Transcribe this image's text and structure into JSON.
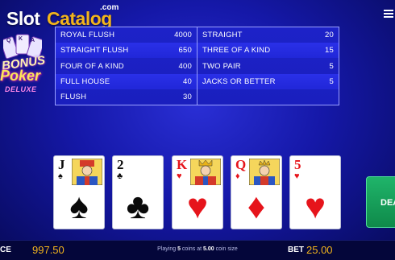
{
  "brand": {
    "slot": "Slot",
    "catalog": "Catalog",
    "com": ".com"
  },
  "game_logo": {
    "line1": "BONUS",
    "line2": "Poker",
    "line3": "DELUXE",
    "card_ranks": [
      "Q",
      "K",
      "A"
    ]
  },
  "paytable": {
    "left": [
      {
        "hand": "ROYAL FLUSH",
        "pay": "4000"
      },
      {
        "hand": "STRAIGHT FLUSH",
        "pay": "650"
      },
      {
        "hand": "FOUR OF A KIND",
        "pay": "400"
      },
      {
        "hand": "FULL HOUSE",
        "pay": "40"
      },
      {
        "hand": "FLUSH",
        "pay": "30"
      }
    ],
    "right": [
      {
        "hand": "STRAIGHT",
        "pay": "20"
      },
      {
        "hand": "THREE OF A KIND",
        "pay": "15"
      },
      {
        "hand": "TWO PAIR",
        "pay": "5"
      },
      {
        "hand": "JACKS OR BETTER",
        "pay": "5"
      }
    ]
  },
  "cards": [
    {
      "rank": "J",
      "suit": "♠",
      "color": "black"
    },
    {
      "rank": "2",
      "suit": "♣",
      "color": "black"
    },
    {
      "rank": "K",
      "suit": "♥",
      "color": "red"
    },
    {
      "rank": "Q",
      "suit": "♦",
      "color": "red"
    },
    {
      "rank": "5",
      "suit": "♥",
      "color": "red"
    }
  ],
  "deal_button": {
    "label": "DEA"
  },
  "bottom": {
    "balance_label": "CE",
    "balance_value": "997.50",
    "coin_info": {
      "prefix": "Playing ",
      "coins": "5",
      "mid": " coins at ",
      "size": "5.00",
      "suffix": " coin size"
    },
    "bet_label": "BET",
    "bet_value": "25.00"
  },
  "colors": {
    "accent": "#f2b41c",
    "background": "#1518a8",
    "deal": "#1fb46a"
  }
}
